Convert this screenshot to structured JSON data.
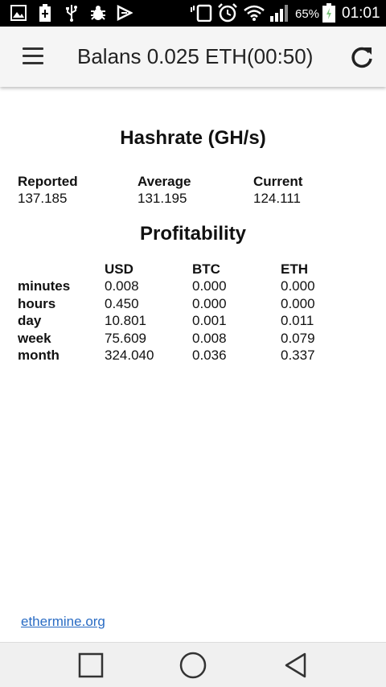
{
  "status_bar": {
    "battery_percent": "65%",
    "time": "01:01",
    "icons": [
      "image-icon",
      "battery-saver-icon",
      "usb-icon",
      "debug-icon",
      "play-store-icon",
      "vibrate-icon",
      "alarm-icon",
      "wifi-icon",
      "signal-icon",
      "battery-icon"
    ]
  },
  "app_bar": {
    "title": "Balans 0.025 ETH(00:50)",
    "menu_icon": "menu-icon",
    "refresh_icon": "refresh-icon"
  },
  "hashrate": {
    "title": "Hashrate (GH/s)",
    "reported": {
      "label": "Reported",
      "value": "137.185"
    },
    "average": {
      "label": "Average",
      "value": "131.195"
    },
    "current": {
      "label": "Current",
      "value": "124.111"
    }
  },
  "profitability": {
    "title": "Profitability",
    "columns": [
      "USD",
      "BTC",
      "ETH"
    ],
    "rows": [
      {
        "label": "minutes",
        "usd": "0.008",
        "btc": "0.000",
        "eth": "0.000"
      },
      {
        "label": "hours",
        "usd": "0.450",
        "btc": "0.000",
        "eth": "0.000"
      },
      {
        "label": "day",
        "usd": "10.801",
        "btc": "0.001",
        "eth": "0.011"
      },
      {
        "label": "week",
        "usd": "75.609",
        "btc": "0.008",
        "eth": "0.079"
      },
      {
        "label": "month",
        "usd": "324.040",
        "btc": "0.036",
        "eth": "0.337"
      }
    ]
  },
  "footer": {
    "link_text": "ethermine.org"
  },
  "nav_bar": {
    "icons": [
      "recents-icon",
      "home-icon",
      "back-icon"
    ]
  },
  "colors": {
    "link": "#2a6cc4",
    "status_bar_bg": "#000000",
    "app_bar_bg": "#f5f5f5",
    "nav_bar_bg": "#f0f0f0"
  }
}
